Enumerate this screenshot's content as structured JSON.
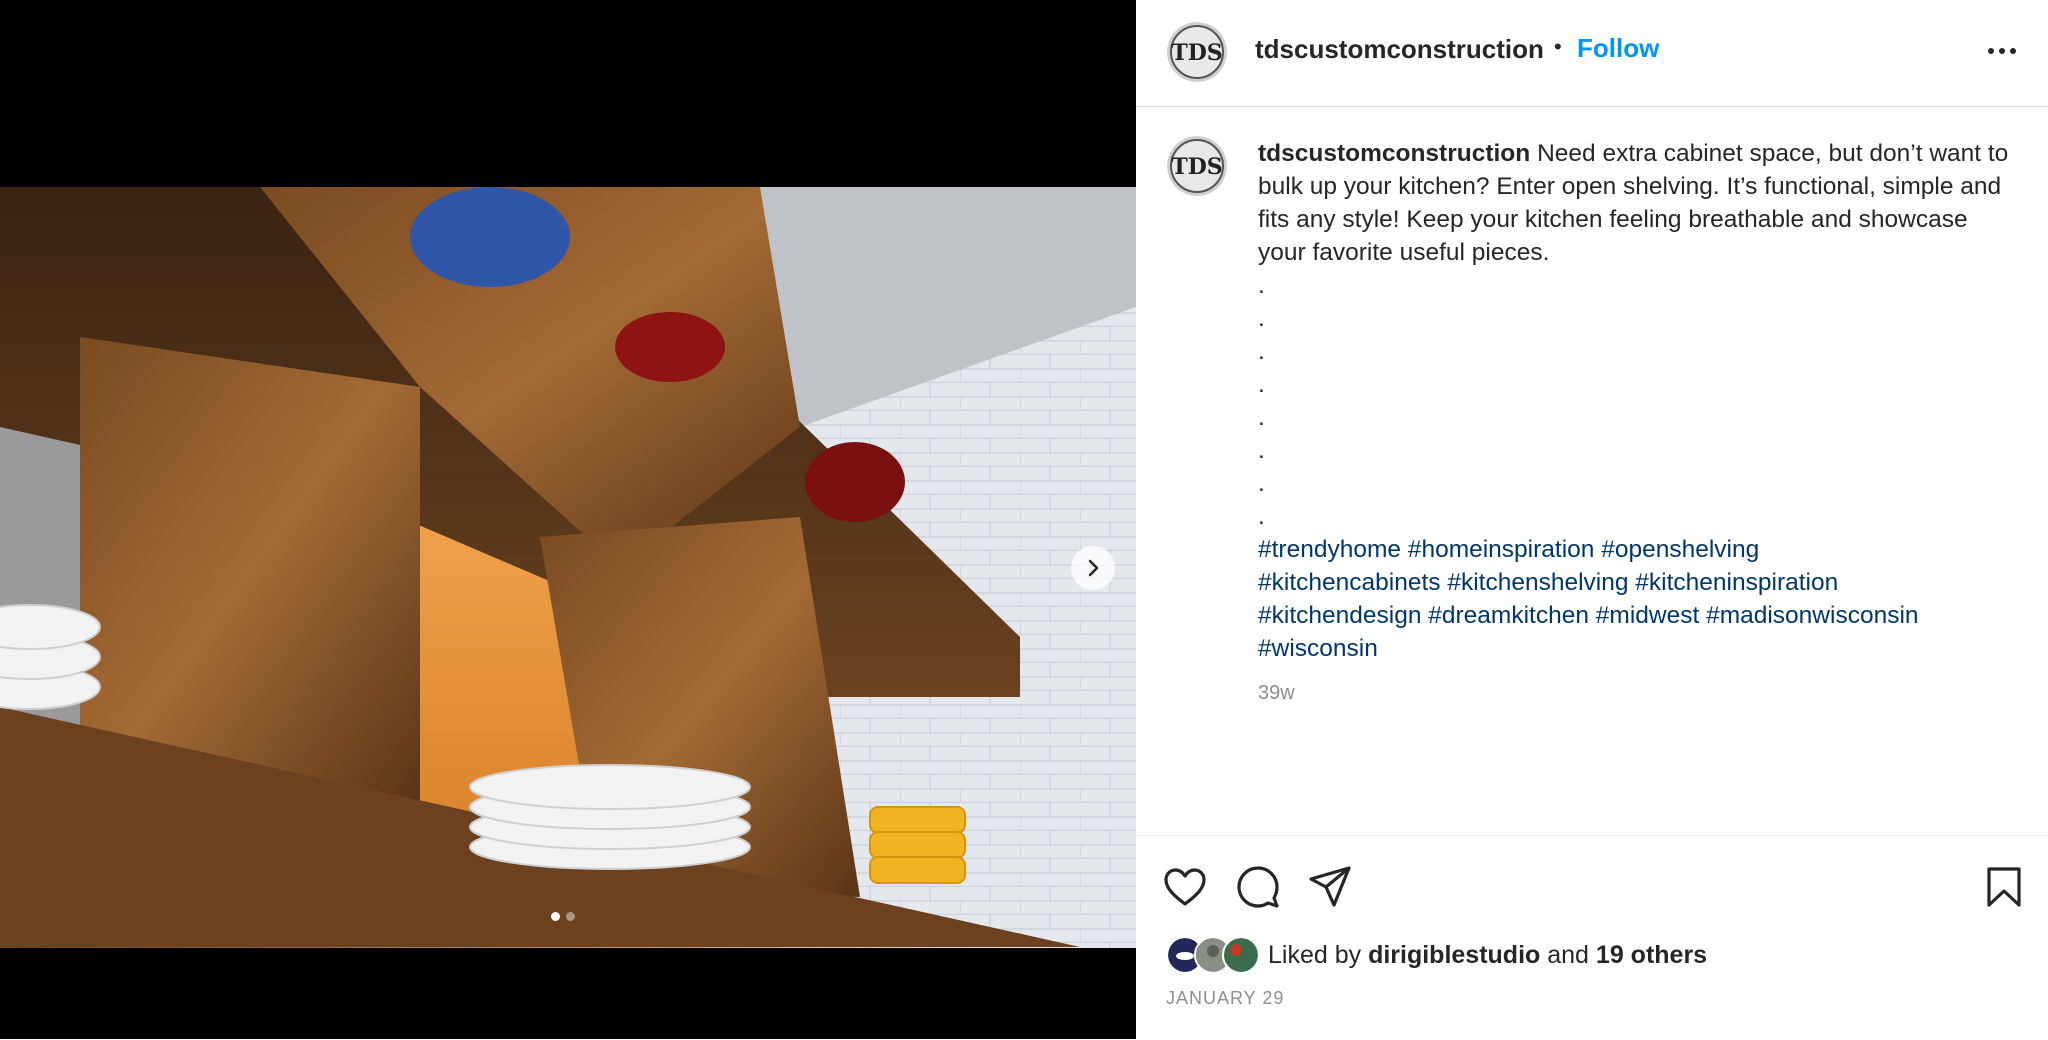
{
  "post": {
    "username": "tdscustomconstruction",
    "separator": "•",
    "follow_label": "Follow",
    "more_icon": "more-horizontal-icon",
    "caption_username": "tdscustomconstruction",
    "caption_text": "Need extra cabinet space, but don’t want to bulk up your kitchen? Enter open shelving. It’s functional, simple and fits any style! Keep your kitchen feeling breathable and showcase your favorite useful pieces.",
    "dots": [
      ".",
      ".",
      ".",
      ".",
      ".",
      ".",
      ".",
      "."
    ],
    "hashtags": [
      "#trendyhome",
      "#homeinspiration",
      "#openshelving",
      "#kitchencabinets",
      "#kitchenshelving",
      "#kitcheninspiration",
      "#kitchendesign",
      "#dreamkitchen",
      "#midwest",
      "#madisonwisconsin",
      "#wisconsin"
    ],
    "time_ago": "39w",
    "liked_by_prefix": "Liked by",
    "liked_by_user": "dirigiblestudio",
    "liked_by_and": "and",
    "liked_by_others": "19 others",
    "date": "JANUARY 29"
  },
  "carousel": {
    "current": 1,
    "total": 2
  },
  "colors": {
    "follow": "#0095f6",
    "hashtag": "#00376b",
    "muted": "#8e8e8e"
  }
}
